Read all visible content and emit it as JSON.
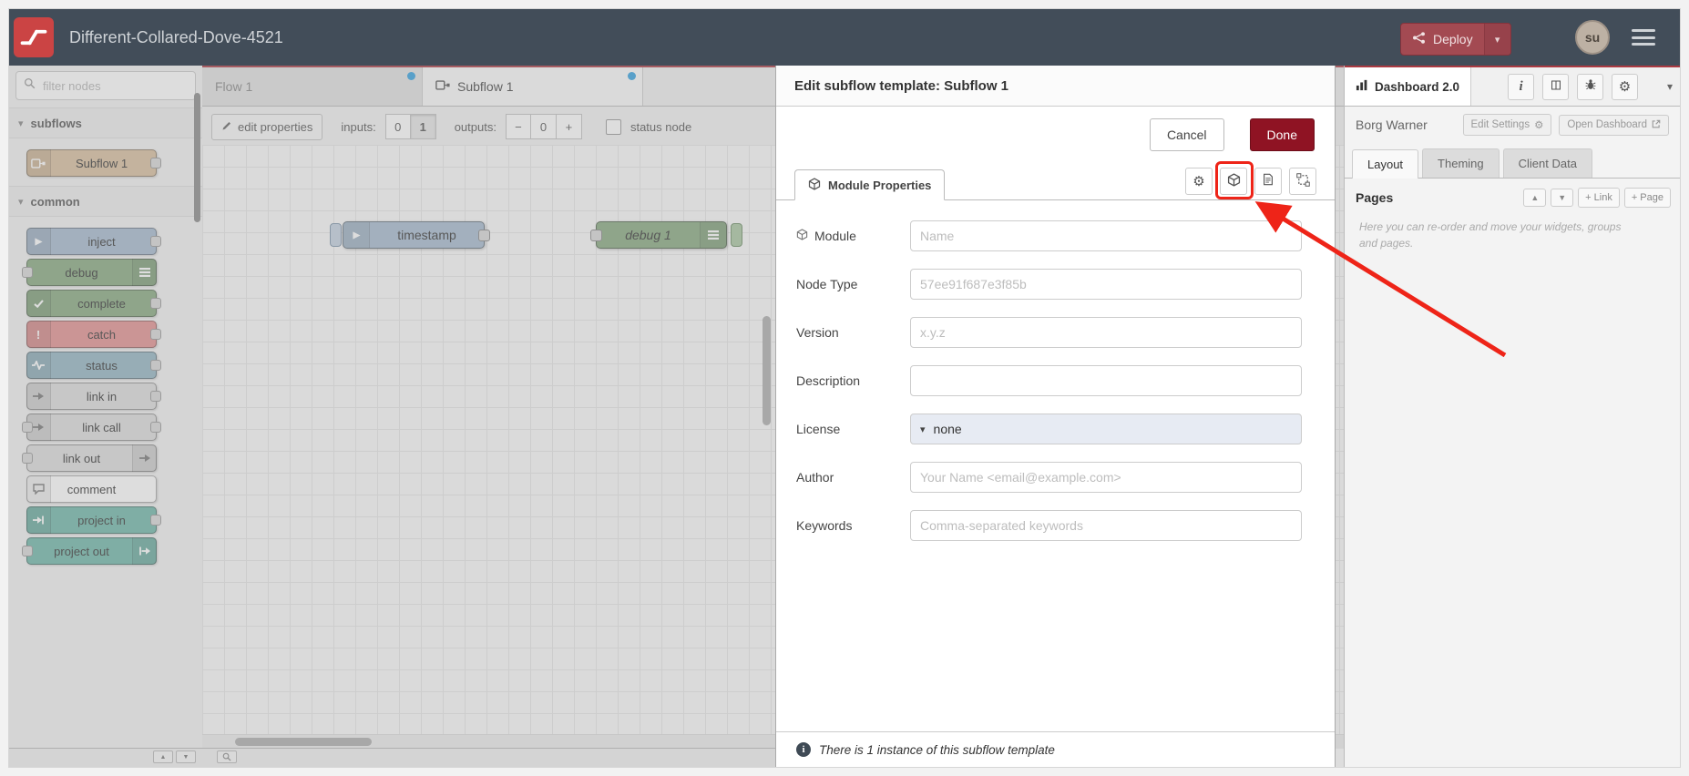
{
  "colors": {
    "header_bg": "#424d59",
    "brand_red": "#cb4444",
    "deploy_red": "#a34a52",
    "done_red": "#8f1323",
    "modified_dot_blue": "#35a1e0",
    "annotation_red": "#ee2418",
    "node_subflow": "#d9bf9e",
    "node_inject": "#a6bbcf",
    "node_debug": "#87a980",
    "node_catch": "#e49191",
    "node_status": "#94b6c4",
    "node_link": "#dddddd",
    "node_comment": "#ffffff",
    "node_project": "#6fb7a9"
  },
  "icons": {
    "caret_down": "▾",
    "chevron_down": "▾",
    "gear": "⚙",
    "up_arrow": "▲",
    "down_arrow": "▼",
    "minus": "−",
    "plus": "+",
    "exclaim": "!",
    "info_i": "i"
  },
  "header": {
    "title": "Different-Collared-Dove-4521",
    "deploy_label": "Deploy",
    "avatar_initials": "su"
  },
  "palette": {
    "filter_placeholder": "filter nodes",
    "category_subflows": "subflows",
    "category_common": "common",
    "subflow_nodes": [
      {
        "label": "Subflow 1"
      }
    ],
    "common_nodes": [
      {
        "label": "inject"
      },
      {
        "label": "debug"
      },
      {
        "label": "complete"
      },
      {
        "label": "catch"
      },
      {
        "label": "status"
      },
      {
        "label": "link in"
      },
      {
        "label": "link call"
      },
      {
        "label": "link out"
      },
      {
        "label": "comment"
      },
      {
        "label": "project in"
      },
      {
        "label": "project out"
      }
    ]
  },
  "workspace": {
    "tabs": [
      {
        "label": "Flow 1"
      },
      {
        "label": "Subflow 1"
      }
    ],
    "toolbar": {
      "edit_properties": "edit properties",
      "inputs_label": "inputs:",
      "input_options": [
        "0",
        "1"
      ],
      "outputs_label": "outputs:",
      "outputs_value": "0",
      "status_node_label": "status node"
    },
    "canvas_nodes": {
      "inject_label": "timestamp",
      "debug_label": "debug 1"
    }
  },
  "dialog": {
    "title": "Edit subflow template: Subflow 1",
    "cancel_label": "Cancel",
    "done_label": "Done",
    "tab_label": "Module Properties",
    "fields": {
      "module_label": "Module",
      "module_placeholder": "Name",
      "node_type_label": "Node Type",
      "node_type_value": "57ee91f687e3f85b",
      "version_label": "Version",
      "version_placeholder": "x.y.z",
      "description_label": "Description",
      "license_label": "License",
      "license_value": "none",
      "author_label": "Author",
      "author_placeholder": "Your Name <email@example.com>",
      "keywords_label": "Keywords",
      "keywords_placeholder": "Comma-separated keywords"
    },
    "footer_note": "There is 1 instance of this subflow template"
  },
  "sidebar": {
    "active_tab": "Dashboard 2.0",
    "project_name": "Borg Warner",
    "edit_settings_label": "Edit Settings",
    "open_dashboard_label": "Open Dashboard",
    "tabs": [
      {
        "label": "Layout"
      },
      {
        "label": "Theming"
      },
      {
        "label": "Client Data"
      }
    ],
    "pages_label": "Pages",
    "add_link_label": "+ Link",
    "add_page_label": "+ Page",
    "hint": "Here you can re-order and move your widgets, groups and pages."
  }
}
